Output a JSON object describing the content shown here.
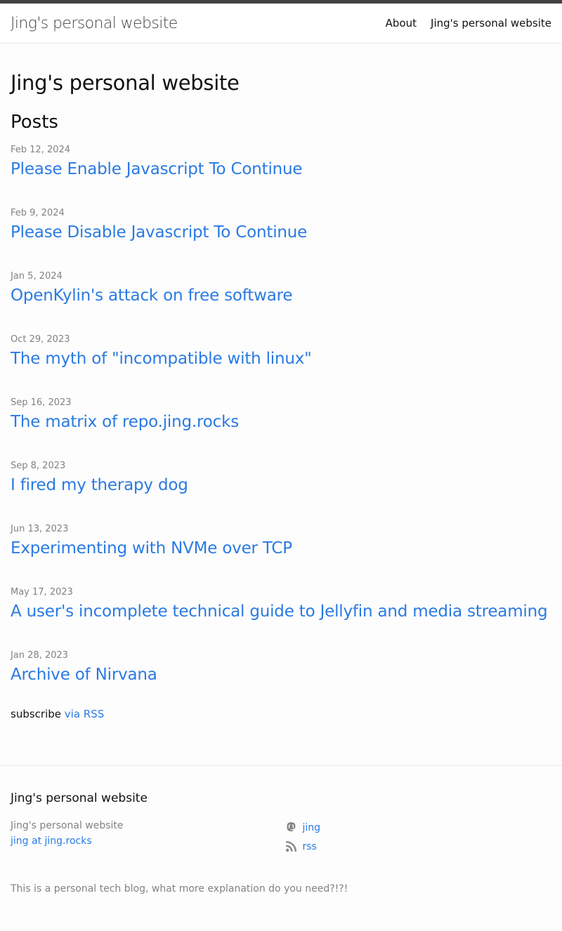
{
  "header": {
    "site_title": "Jing's personal website",
    "nav": [
      {
        "label": "About"
      },
      {
        "label": "Jing's personal website"
      }
    ]
  },
  "main": {
    "page_heading": "Jing's personal website",
    "posts_heading": "Posts",
    "posts": [
      {
        "date": "Feb 12, 2024",
        "title": "Please Enable Javascript To Continue"
      },
      {
        "date": "Feb 9, 2024",
        "title": "Please Disable Javascript To Continue"
      },
      {
        "date": "Jan 5, 2024",
        "title": "OpenKylin's attack on free software"
      },
      {
        "date": "Oct 29, 2023",
        "title": "The myth of \"incompatible with linux\""
      },
      {
        "date": "Sep 16, 2023",
        "title": "The matrix of repo.jing.rocks"
      },
      {
        "date": "Sep 8, 2023",
        "title": "I fired my therapy dog"
      },
      {
        "date": "Jun 13, 2023",
        "title": "Experimenting with NVMe over TCP"
      },
      {
        "date": "May 17, 2023",
        "title": "A user's incomplete technical guide to Jellyfin and media streaming"
      },
      {
        "date": "Jan 28, 2023",
        "title": "Archive of Nirvana"
      }
    ],
    "subscribe_text": "subscribe",
    "subscribe_link": "via RSS"
  },
  "footer": {
    "heading": "Jing's personal website",
    "contact_name": "Jing's personal website",
    "contact_email": "jing at jing.rocks",
    "social": [
      {
        "icon": "mastodon-icon",
        "label": "jing"
      },
      {
        "icon": "rss-icon",
        "label": "rss"
      }
    ],
    "description": "This is a personal tech blog, what more explanation do you need?!?!"
  },
  "colors": {
    "link": "#2a7ae2",
    "meta": "#828282",
    "top_strip": "#424242"
  }
}
